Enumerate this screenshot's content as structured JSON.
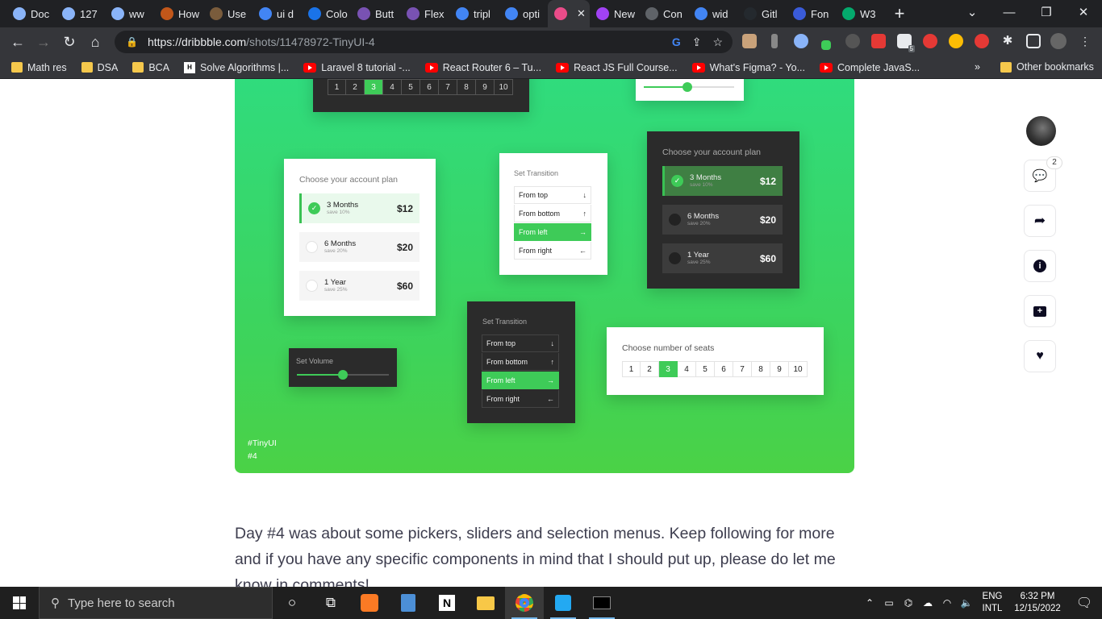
{
  "tabs": [
    {
      "label": "Doc",
      "icon": "globe-icon",
      "color": "#8ab4f8"
    },
    {
      "label": "127",
      "icon": "globe-icon",
      "color": "#8ab4f8"
    },
    {
      "label": "ww",
      "icon": "globe-icon",
      "color": "#8ab4f8"
    },
    {
      "label": "How",
      "icon": "site-icon",
      "color": "#c2571a"
    },
    {
      "label": "Use",
      "icon": "site-icon",
      "color": "#7a5c3c"
    },
    {
      "label": "ui d",
      "icon": "google-icon",
      "color": "#4285f4"
    },
    {
      "label": "Colo",
      "icon": "dot-icon",
      "color": "#1a73e8"
    },
    {
      "label": "Butt",
      "icon": "bootstrap-icon",
      "color": "#7952b3"
    },
    {
      "label": "Flex",
      "icon": "bootstrap-icon",
      "color": "#7952b3"
    },
    {
      "label": "tripl",
      "icon": "google-icon",
      "color": "#4285f4"
    },
    {
      "label": "opti",
      "icon": "google-icon",
      "color": "#4285f4"
    },
    {
      "label": "",
      "icon": "dribbble-icon",
      "color": "#ea4c89",
      "active": true
    },
    {
      "label": "New",
      "icon": "site-icon",
      "color": "#a142f4"
    },
    {
      "label": "Con",
      "icon": "speaker-icon",
      "color": "#5f6368"
    },
    {
      "label": "wid",
      "icon": "google-icon",
      "color": "#4285f4"
    },
    {
      "label": "Gitl",
      "icon": "github-icon",
      "color": "#24292e"
    },
    {
      "label": "Fon",
      "icon": "flag-icon",
      "color": "#3a5bd9"
    },
    {
      "label": "W3",
      "icon": "w3-icon",
      "color": "#04aa6d"
    }
  ],
  "browser": {
    "url_host": "https://dribbble.com",
    "url_path": "/shots/11478972-TinyUI-4",
    "extension_badge": "5"
  },
  "bookmarks": [
    {
      "label": "Math res",
      "type": "folder"
    },
    {
      "label": "DSA",
      "type": "folder"
    },
    {
      "label": "BCA",
      "type": "folder"
    },
    {
      "label": "Solve Algorithms |...",
      "type": "hackerrank"
    },
    {
      "label": "Laravel 8 tutorial -...",
      "type": "youtube"
    },
    {
      "label": "React Router 6 – Tu...",
      "type": "youtube"
    },
    {
      "label": "React JS Full Course...",
      "type": "youtube"
    },
    {
      "label": "What's Figma? - Yo...",
      "type": "youtube"
    },
    {
      "label": "Complete JavaS...",
      "type": "youtube"
    }
  ],
  "bookmarks_more": "»",
  "other_bookmarks": "Other bookmarks",
  "shot": {
    "top_pager": [
      "1",
      "2",
      "3",
      "4",
      "5",
      "6",
      "7",
      "8",
      "9",
      "10"
    ],
    "plan_light": {
      "title": "Choose your account plan",
      "plans": [
        {
          "name": "3 Months",
          "save": "save 10%",
          "price": "$12",
          "selected": true
        },
        {
          "name": "6 Months",
          "save": "save 20%",
          "price": "$20",
          "selected": false
        },
        {
          "name": "1 Year",
          "save": "save 25%",
          "price": "$60",
          "selected": false
        }
      ]
    },
    "plan_dark": {
      "title": "Choose your account plan",
      "plans": [
        {
          "name": "3 Months",
          "save": "save 10%",
          "price": "$12",
          "selected": true
        },
        {
          "name": "6 Months",
          "save": "save 20%",
          "price": "$20",
          "selected": false
        },
        {
          "name": "1 Year",
          "save": "save 25%",
          "price": "$60",
          "selected": false
        }
      ]
    },
    "transition_light": {
      "title": "Set Transition",
      "items": [
        {
          "label": "From top",
          "arrow": "↓",
          "selected": false
        },
        {
          "label": "From bottom",
          "arrow": "↑",
          "selected": false
        },
        {
          "label": "From left",
          "arrow": "→",
          "selected": true
        },
        {
          "label": "From right",
          "arrow": "←",
          "selected": false
        }
      ]
    },
    "transition_dark": {
      "title": "Set Transition",
      "items": [
        {
          "label": "From top",
          "arrow": "↓",
          "selected": false
        },
        {
          "label": "From bottom",
          "arrow": "↑",
          "selected": false
        },
        {
          "label": "From left",
          "arrow": "→",
          "selected": true
        },
        {
          "label": "From right",
          "arrow": "←",
          "selected": false
        }
      ]
    },
    "volume": {
      "title": "Set Volume",
      "level": 0.5
    },
    "seats": {
      "title": "Choose number of seats",
      "options": [
        "1",
        "2",
        "3",
        "4",
        "5",
        "6",
        "7",
        "8",
        "9",
        "10"
      ],
      "selected": "3"
    },
    "tags": [
      "#TinyUI",
      "#4"
    ]
  },
  "rail": {
    "comments_count": "2"
  },
  "description": "Day #4 was about some pickers, sliders and selection menus. Keep following for more and if you have any specific components in mind that I should put up, please do let me know in comments!",
  "taskbar": {
    "search_placeholder": "Type here to search",
    "lang_top": "ENG",
    "lang_bottom": "INTL",
    "time": "6:32 PM",
    "date": "12/15/2022"
  }
}
